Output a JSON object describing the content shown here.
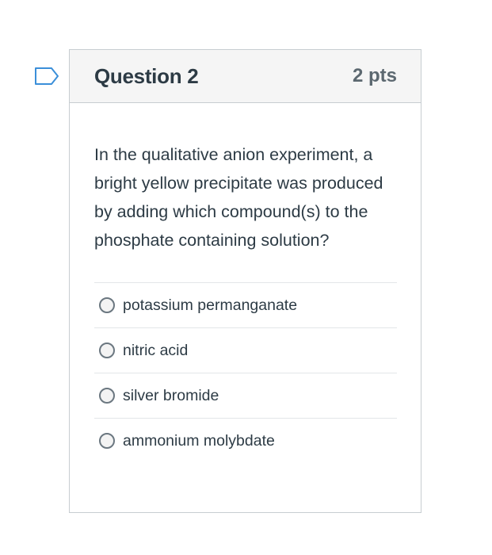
{
  "question": {
    "title": "Question 2",
    "points": "2 pts",
    "text": "In the qualitative anion experiment, a bright yellow precipitate was produced by adding which compound(s) to the phosphate containing solution?",
    "flag_icon": "flag-outline-icon",
    "answers": [
      {
        "label": "potassium permanganate",
        "selected": false
      },
      {
        "label": "nitric acid",
        "selected": false
      },
      {
        "label": "silver bromide",
        "selected": false
      },
      {
        "label": "ammonium molybdate",
        "selected": false
      }
    ]
  },
  "colors": {
    "header_bg": "#f5f5f5",
    "border": "#c7cdd1",
    "text": "#2d3b45",
    "points_text": "#5c6870",
    "flag_stroke": "#3b8fd9"
  }
}
